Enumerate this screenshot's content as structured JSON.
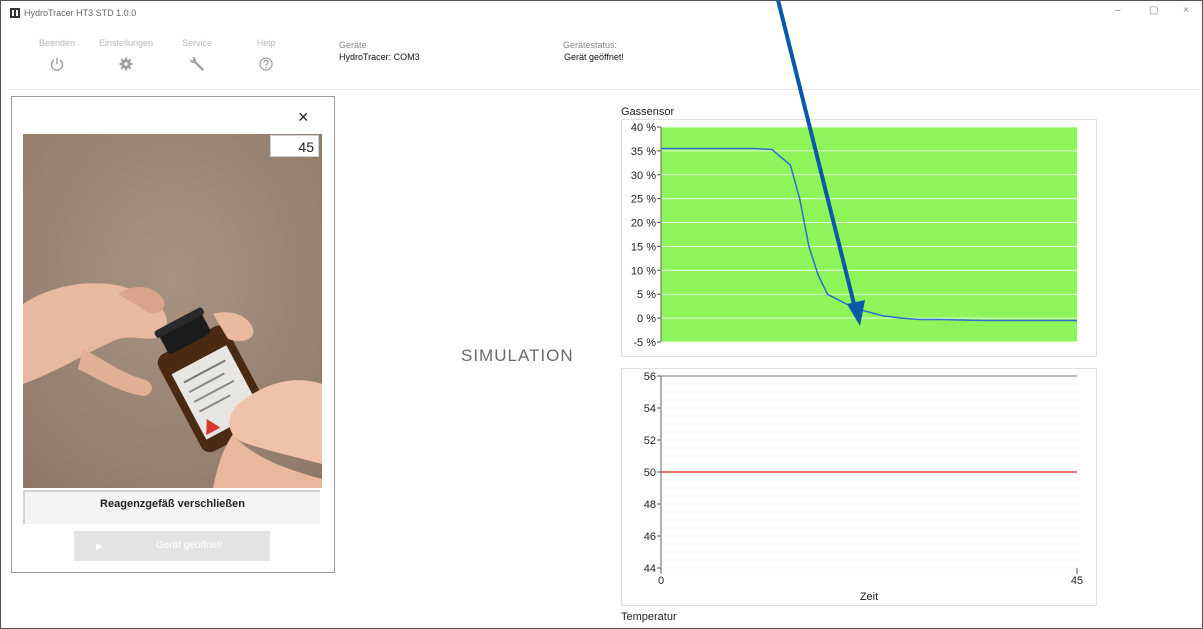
{
  "window": {
    "title": "HydroTracer HT3 STD 1.0.0",
    "controls": [
      "–",
      "▢",
      "×"
    ]
  },
  "toolbar": {
    "items": [
      {
        "label": "Beenden",
        "icon": "power-icon"
      },
      {
        "label": "Einstellungen",
        "icon": "gear-icon"
      },
      {
        "label": "Service",
        "icon": "wrench-icon"
      },
      {
        "label": "Help",
        "icon": "help-icon"
      }
    ]
  },
  "header": {
    "devices_label": "Geräte",
    "devices_value": "HydroTracer: COM3",
    "status_label": "Gerätestatus:",
    "status_value": "Gerät geöffnet!"
  },
  "panel": {
    "close_symbol": "×",
    "counter": "45",
    "instruction": "Reagenzgefäß verschließen",
    "button_label": "Gerät geöffnet!",
    "button_icon": "play-icon"
  },
  "simulation_label": "SIMULATION",
  "colors": {
    "gas_plot_bg": "#8df55a",
    "gas_line": "#2a6fd1",
    "temp_line": "#e8453c",
    "arrow": "#0b57a8"
  },
  "chart_data": [
    {
      "type": "line",
      "title": "Gassensor",
      "ylim": [
        -5,
        40
      ],
      "yticks": [
        "40 %",
        "35 %",
        "30 %",
        "25 %",
        "20 %",
        "15 %",
        "10 %",
        "5 %",
        "0 %",
        "-5 %"
      ],
      "xlim": [
        0,
        45
      ],
      "series": [
        {
          "x": [
            0,
            2,
            6,
            10,
            12,
            14,
            15,
            16,
            17,
            18,
            20,
            22,
            24,
            26,
            28,
            30,
            35,
            40,
            45
          ],
          "values": [
            35.5,
            35.5,
            35.5,
            35.5,
            35.3,
            32,
            25,
            15,
            9,
            5,
            3,
            1.5,
            0.5,
            0,
            -0.3,
            -0.3,
            -0.5,
            -0.5,
            -0.5
          ]
        }
      ],
      "grid": true
    },
    {
      "type": "line",
      "title": "Temperatur",
      "xlabel": "Zeit",
      "ylim": [
        44,
        56
      ],
      "yticks": [
        "56",
        "54",
        "52",
        "50",
        "48",
        "46",
        "44"
      ],
      "xticks": [
        "0",
        "45"
      ],
      "xlim": [
        0,
        45
      ],
      "series": [
        {
          "x": [
            0,
            45
          ],
          "values": [
            50,
            50
          ]
        },
        {
          "x": [
            0,
            45
          ],
          "values": [
            56,
            56
          ]
        }
      ],
      "grid": true
    }
  ]
}
